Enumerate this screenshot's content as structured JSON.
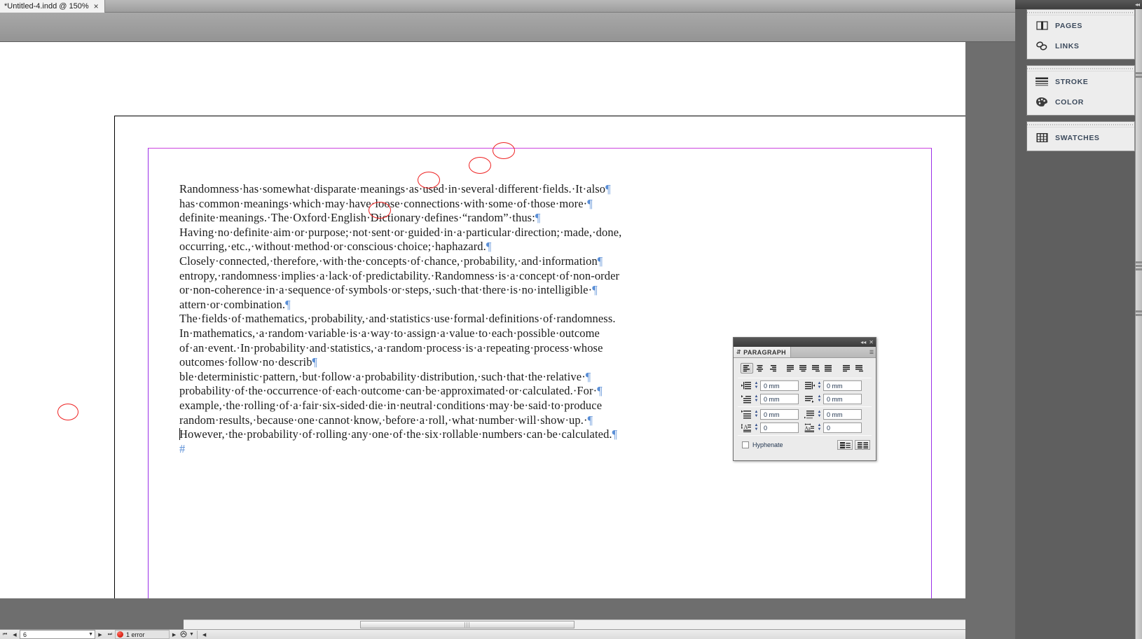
{
  "window": {
    "tab": {
      "title": "*Untitled-4.indd @ 150%",
      "close_label": "×"
    }
  },
  "document": {
    "lines": [
      {
        "text": "Randomness has somewhat disparate meanings as used in several different fields. It also",
        "mark": "¶",
        "circled": true
      },
      {
        "text": "has common meanings which may have loose connections with some of those more ",
        "mark": "¶",
        "circled": true
      },
      {
        "text": "definite meanings. The Oxford English Dictionary defines “random” thus:",
        "mark": "¶",
        "circled": true
      },
      {
        "text": "Having no definite aim or purpose; not sent or guided in a particular direction; made, done,",
        "mark": "",
        "circled": false
      },
      {
        "text": "occurring, etc., without method or conscious choice; haphazard.",
        "mark": "¶",
        "circled": true
      },
      {
        "text": "Closely connected, therefore, with the concepts of chance, probability, and information",
        "mark": "¶",
        "circled": false
      },
      {
        "text": "entropy, randomness implies a lack of predictability. Randomness is a concept of non-order",
        "mark": "",
        "circled": false
      },
      {
        "text": "or non-coherence in a sequence of symbols or steps, such that there is no intelligible ",
        "mark": "¶",
        "circled": false
      },
      {
        "text": "attern or combination.",
        "mark": "¶",
        "circled": false
      },
      {
        "text": "The fields of mathematics, probability, and statistics use formal definitions of randomness.",
        "mark": "",
        "circled": false
      },
      {
        "text": "In mathematics, a random variable is a way to assign a value to each possible outcome",
        "mark": "",
        "circled": false
      },
      {
        "text": "of an event. In probability and statistics, a random process is a repeating process whose",
        "mark": "",
        "circled": false
      },
      {
        "text": "outcomes follow no describ",
        "mark": "¶",
        "circled": false
      },
      {
        "text": "ble deterministic pattern, but follow a probability distribution, such that the relative ",
        "mark": "¶",
        "circled": false
      },
      {
        "text": "probability of the occurrence of each outcome can be approximated or calculated. For ",
        "mark": "¶",
        "circled": false
      },
      {
        "text": "example, the rolling of a fair six-sided die in neutral conditions may be said to produce",
        "mark": "",
        "circled": false
      },
      {
        "text": "random results, because one cannot know, before a roll, what number will show up. ",
        "mark": "¶",
        "circled": false
      },
      {
        "text": "However, the probability of rolling any one of the six rollable numbers can be calculated.",
        "mark": "¶",
        "circled": false
      }
    ],
    "end_of_story_mark": "#",
    "end_of_story_circled": true
  },
  "statusbar": {
    "first_page_icon": "first-page-icon",
    "prev_page_icon": "prev-page-icon",
    "page_value": "6",
    "page_dropdown_icon": "chevron-down-icon",
    "next_page_icon": "next-page-icon",
    "last_page_icon": "last-page-icon",
    "error_text": "1 error",
    "error_color": "#d41b0d",
    "error_expand_icon": "chevron-right-icon",
    "preflight_icon": "preflight-icon",
    "preflight_dropdown_icon": "chevron-down-icon",
    "resize_icon": "chevron-left-icon"
  },
  "dock": {
    "collapse_icon": "collapse-panels-icon",
    "groups": [
      {
        "items": [
          {
            "label": "PAGES",
            "icon": "pages-icon"
          },
          {
            "label": "LINKS",
            "icon": "links-icon"
          }
        ]
      },
      {
        "items": [
          {
            "label": "STROKE",
            "icon": "stroke-icon"
          },
          {
            "label": "COLOR",
            "icon": "color-icon"
          }
        ]
      },
      {
        "items": [
          {
            "label": "SWATCHES",
            "icon": "swatches-icon"
          }
        ]
      }
    ]
  },
  "paragraph_panel": {
    "title": "PARAGRAPH",
    "grip_icon": "panel-grip-icon",
    "collapse_icon": "collapse-icon",
    "close_icon": "close-icon",
    "menu_icon": "panel-menu-icon",
    "alignment_buttons": [
      {
        "name": "align-left",
        "selected": true
      },
      {
        "name": "align-center",
        "selected": false
      },
      {
        "name": "align-right",
        "selected": false
      },
      {
        "name": "justify-last-left",
        "selected": false
      },
      {
        "name": "justify-last-center",
        "selected": false
      },
      {
        "name": "justify-last-right",
        "selected": false
      },
      {
        "name": "justify-all",
        "selected": false
      },
      {
        "name": "align-toward-spine",
        "selected": false
      },
      {
        "name": "align-away-spine",
        "selected": false
      }
    ],
    "fields": [
      {
        "name": "left-indent",
        "icon": "left-indent-icon",
        "value": "0 mm"
      },
      {
        "name": "right-indent",
        "icon": "right-indent-icon",
        "value": "0 mm"
      },
      {
        "name": "first-line-indent",
        "icon": "first-line-indent-icon",
        "value": "0 mm"
      },
      {
        "name": "last-line-indent",
        "icon": "last-line-indent-icon",
        "value": "0 mm"
      },
      {
        "name": "space-before",
        "icon": "space-before-icon",
        "value": "0 mm"
      },
      {
        "name": "space-after",
        "icon": "space-after-icon",
        "value": "0 mm"
      },
      {
        "name": "drop-cap-lines",
        "icon": "drop-cap-lines-icon",
        "value": "0"
      },
      {
        "name": "drop-cap-chars",
        "icon": "drop-cap-chars-icon",
        "value": "0"
      }
    ],
    "hyphenate": {
      "label": "Hyphenate",
      "checked": false
    },
    "bottom_buttons": [
      {
        "name": "justification-button",
        "icon": "justification-icon"
      },
      {
        "name": "paragraph-rules-button",
        "icon": "paragraph-rules-icon"
      }
    ]
  },
  "colors": {
    "margin_guide": "#cc44e0",
    "page_border": "#000000",
    "pilcrow": "#5b8fd6",
    "annotation": "#ee2222",
    "dock_label": "#3c4a5c"
  }
}
